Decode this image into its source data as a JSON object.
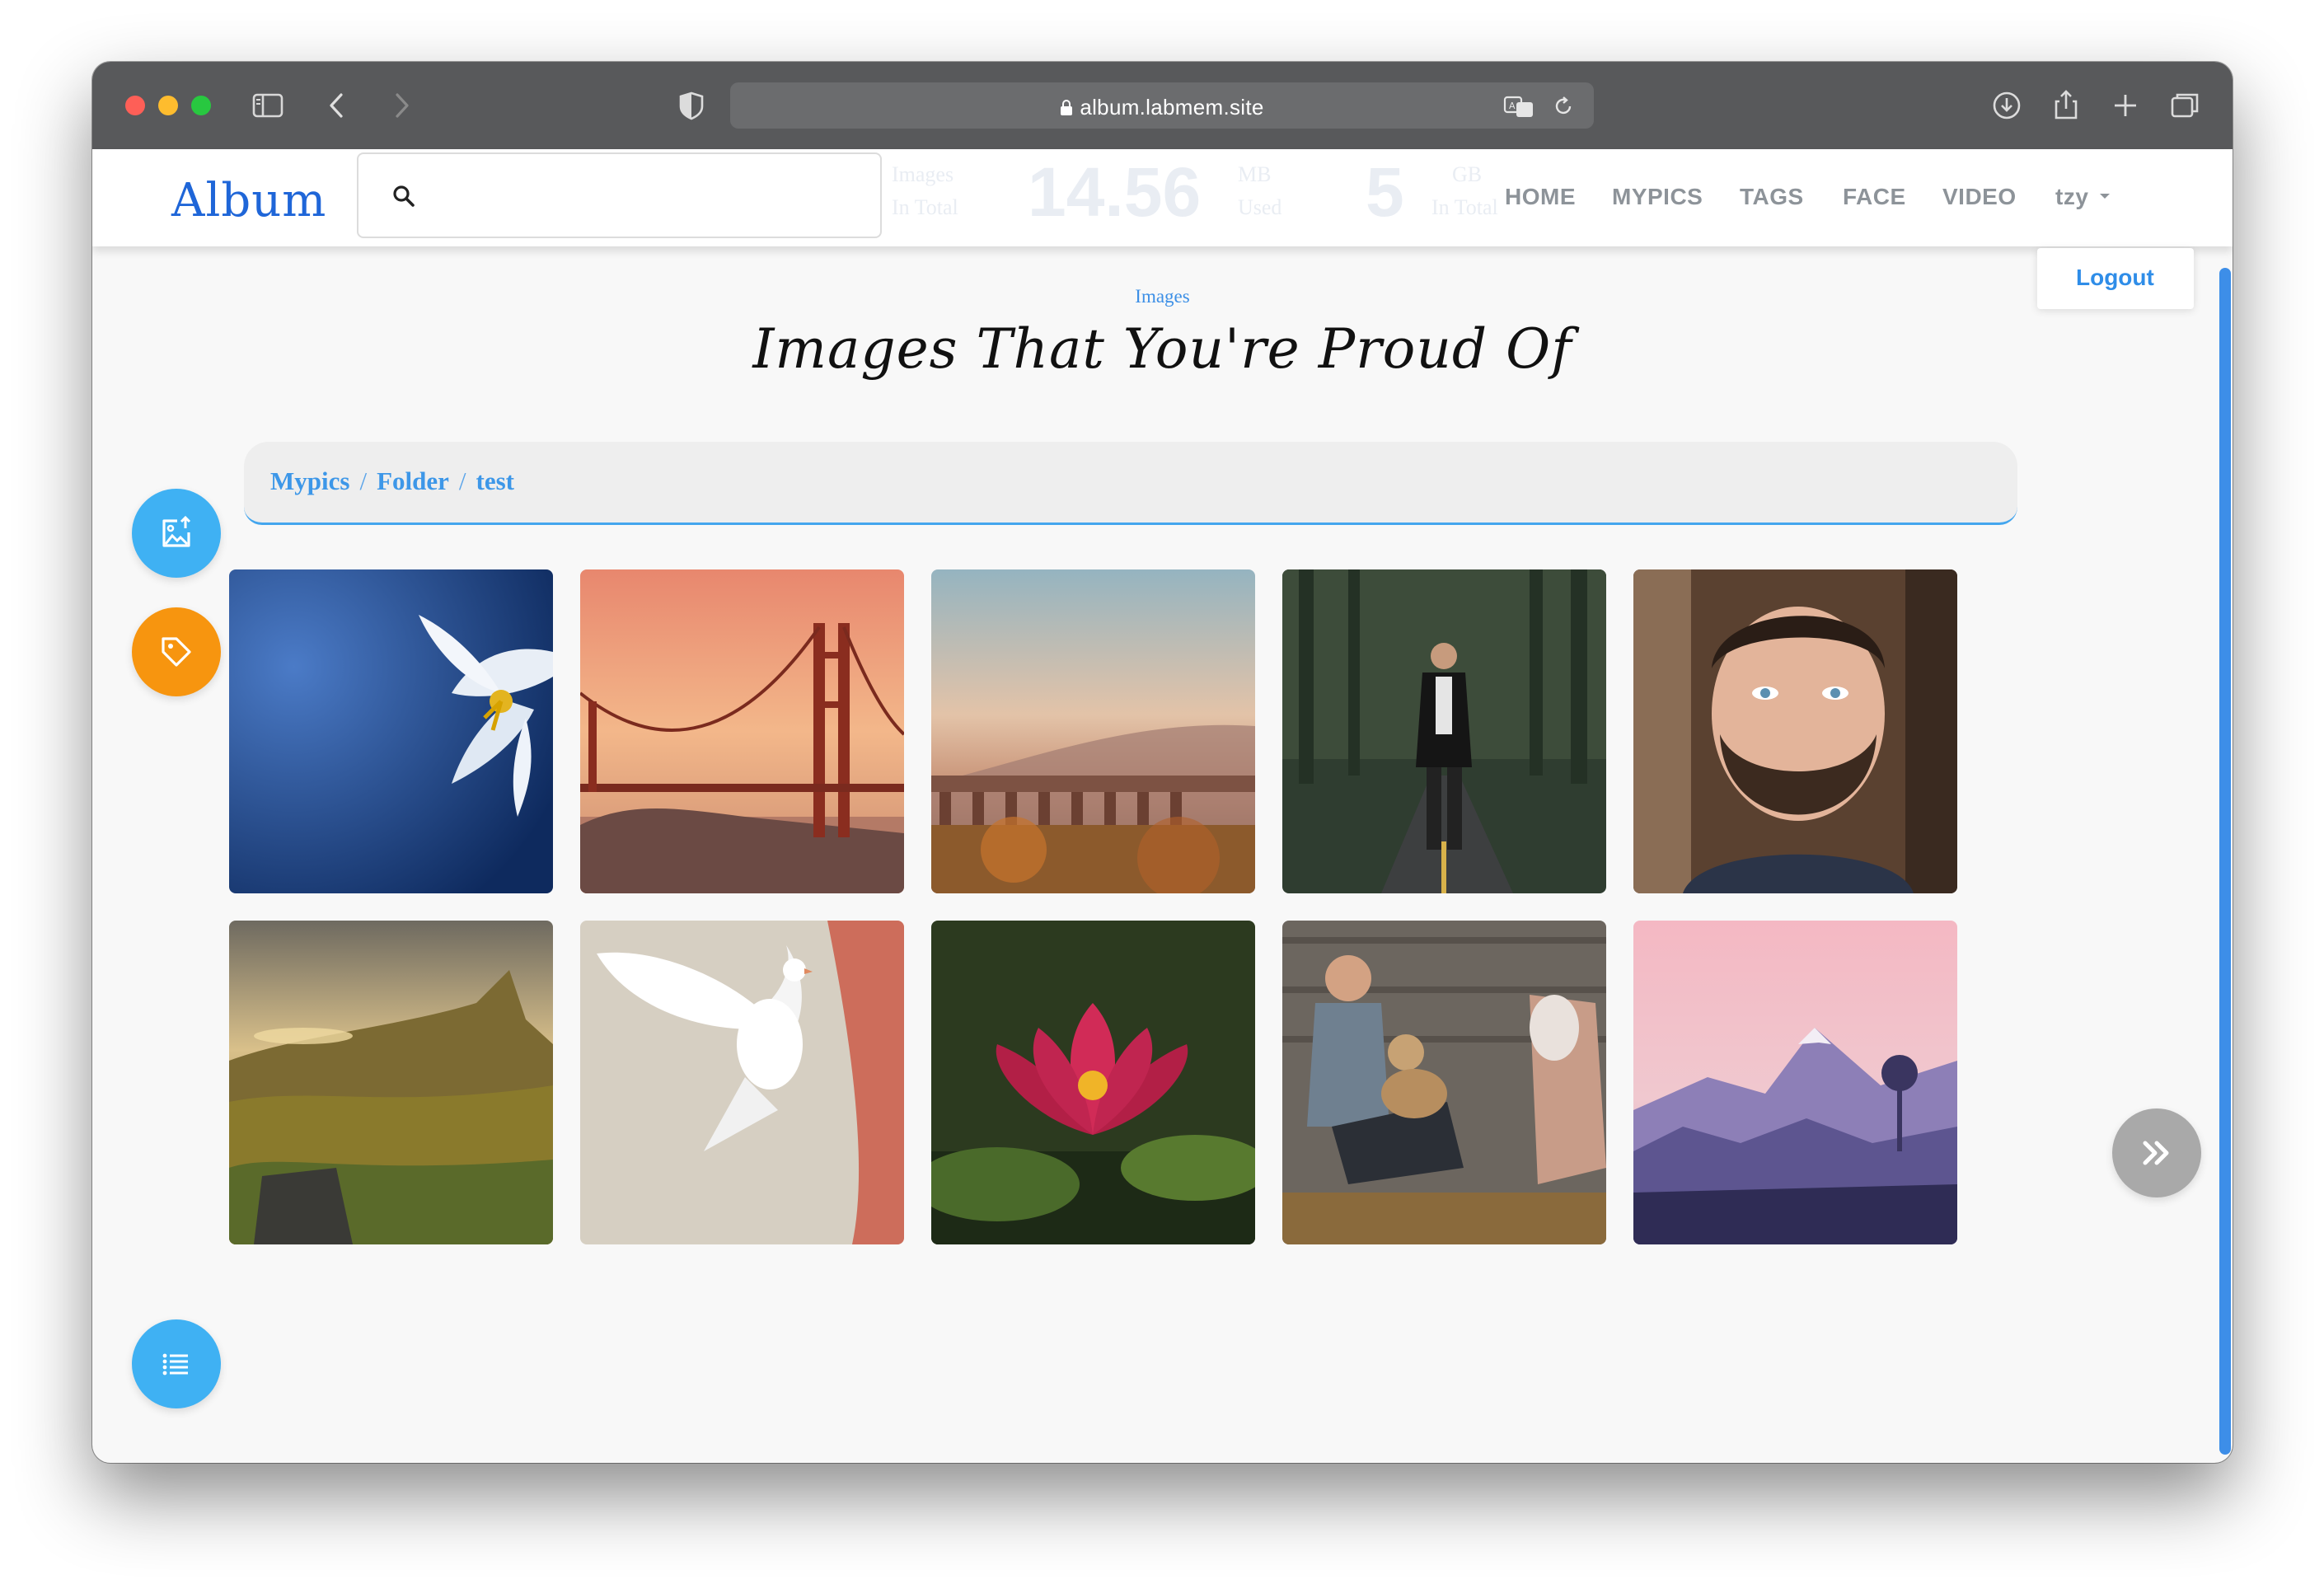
{
  "browser": {
    "url": "album.labmem.site"
  },
  "header": {
    "brand": "Album",
    "stats": [
      {
        "label_top": "Images",
        "label_bottom": "In Total"
      },
      {
        "value": "14.56",
        "label_top": "MB",
        "label_bottom": "Used"
      },
      {
        "value": "5",
        "label_top": "GB",
        "label_bottom": "In Total"
      }
    ],
    "nav": [
      "HOME",
      "MYPICS",
      "TAGS",
      "FACE",
      "VIDEO"
    ],
    "user": "tzy",
    "dropdown": {
      "logout": "Logout"
    }
  },
  "page": {
    "subtitle": "Images",
    "title": "Images That You're Proud Of"
  },
  "breadcrumb": [
    "Mypics",
    "Folder",
    "test"
  ],
  "gallery": [
    "lily-flower-image",
    "golden-gate-bridge-image",
    "viaduct-sunset-image",
    "man-on-road-image",
    "bearded-man-image",
    "highland-landscape-image",
    "white-dove-image",
    "water-lily-image",
    "friends-with-dog-image",
    "purple-mountain-image"
  ],
  "colors": {
    "accent": "#3d97e8",
    "fab_blue": "#3fb1f3",
    "fab_orange": "#f7950f",
    "brand": "#1f66d8"
  }
}
